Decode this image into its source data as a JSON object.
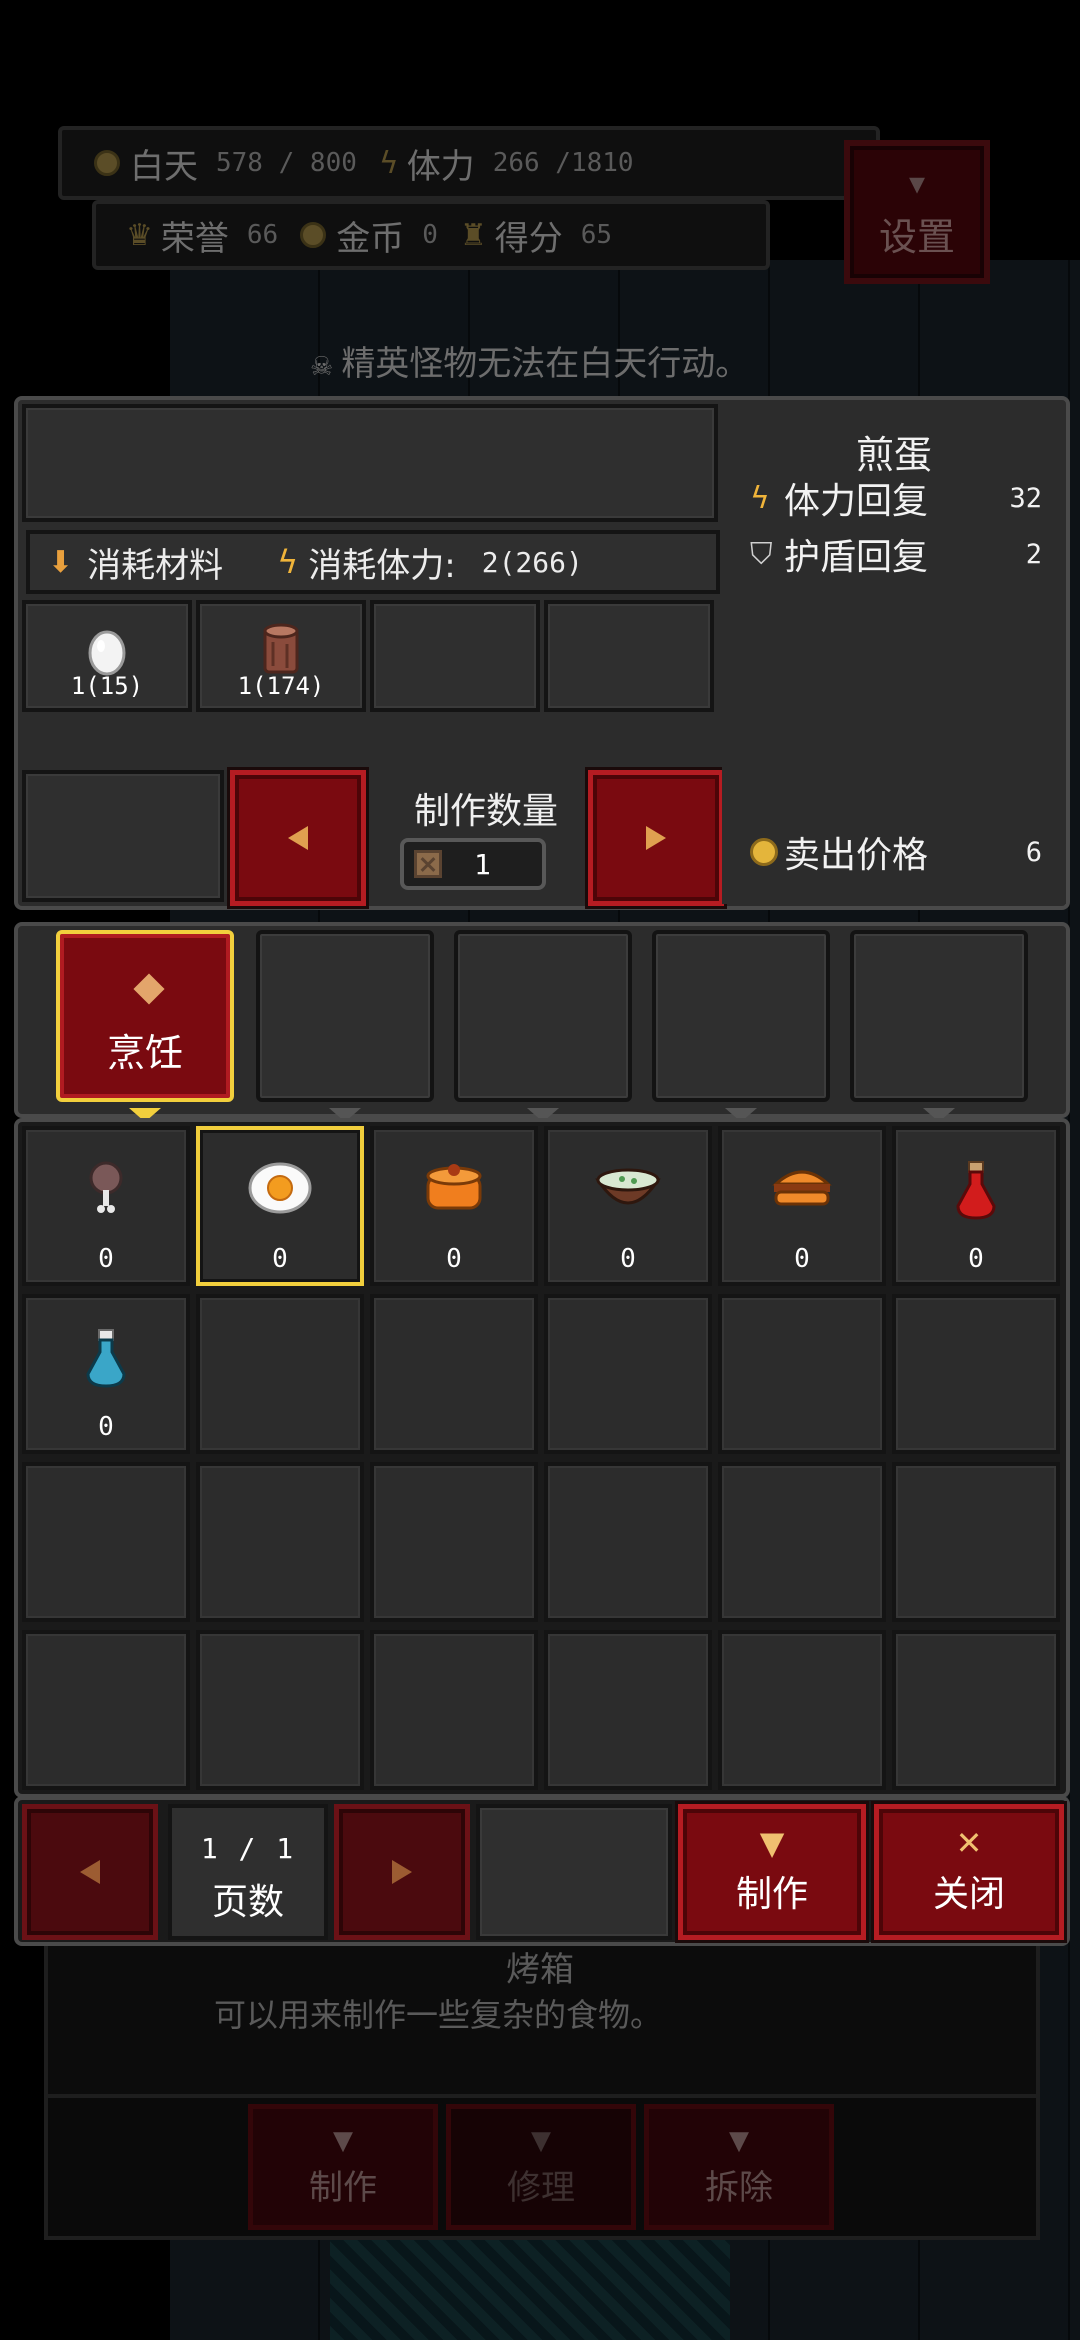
{
  "hud": {
    "day_label": "白天",
    "day_value": "578 / 800",
    "stamina_label": "体力",
    "stamina_value": "266 /1810",
    "honor_label": "荣誉",
    "honor_value": "66",
    "gold_label": "金币",
    "gold_value": "0",
    "score_label": "得分",
    "score_value": "65",
    "settings_label": "设置"
  },
  "notice": "精英怪物无法在白天行动。",
  "craft": {
    "materials_label": "消耗材料",
    "stamina_cost_label": "消耗体力:",
    "stamina_cost_value": "2(266)",
    "materials": [
      {
        "icon": "egg-icon",
        "qty": "1(15)"
      },
      {
        "icon": "wood-log-icon",
        "qty": "1(174)"
      }
    ],
    "quantity_label": "制作数量",
    "quantity_value": "1"
  },
  "info": {
    "item_name": "煎蛋",
    "stamina_restore_label": "体力回复",
    "stamina_restore_value": "32",
    "shield_restore_label": "护盾回复",
    "shield_restore_value": "2",
    "sell_price_label": "卖出价格",
    "sell_price_value": "6"
  },
  "tabs": [
    {
      "label": "烹饪",
      "active": true
    },
    {
      "label": "",
      "active": false
    },
    {
      "label": "",
      "active": false
    },
    {
      "label": "",
      "active": false
    },
    {
      "label": "",
      "active": false
    }
  ],
  "recipes": [
    {
      "icon": "drumstick-icon",
      "count": "0"
    },
    {
      "icon": "fried-egg-icon",
      "count": "0",
      "selected": true
    },
    {
      "icon": "pudding-icon",
      "count": "0"
    },
    {
      "icon": "soup-bowl-icon",
      "count": "0"
    },
    {
      "icon": "burger-icon",
      "count": "0"
    },
    {
      "icon": "red-potion-icon",
      "count": "0"
    },
    {
      "icon": "blue-potion-icon",
      "count": "0"
    }
  ],
  "pagination": {
    "page": "1 / 1",
    "label": "页数"
  },
  "actions": {
    "craft_label": "制作",
    "close_label": "关闭"
  },
  "background": {
    "station_title": "烤箱",
    "station_desc": "可以用来制作一些复杂的食物。",
    "btn_craft": "制作",
    "btn_repair": "修理",
    "btn_dismantle": "拆除"
  },
  "colors": {
    "accent_red": "#7a0a10",
    "highlight_gold": "#f2cf3d",
    "panel": "#2c2c2c"
  }
}
